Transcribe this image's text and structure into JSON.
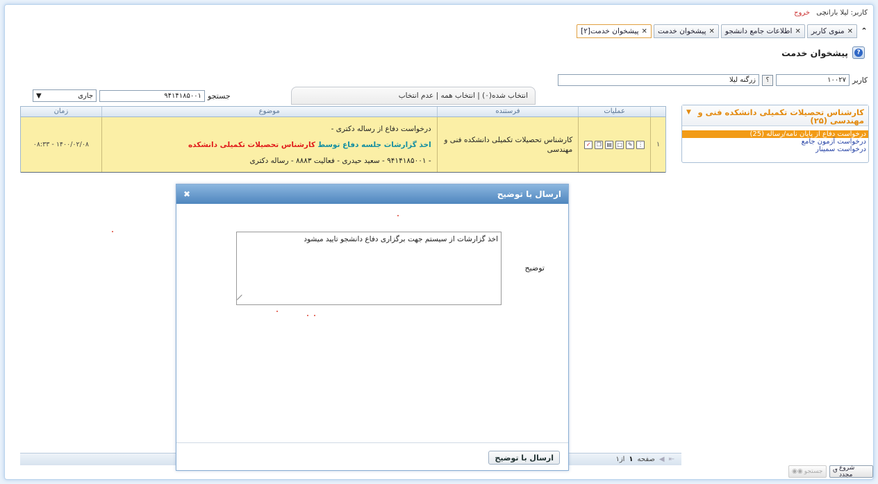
{
  "header": {
    "user_prefix": "کاربر: لیلا بارانچی",
    "logout": "خروج"
  },
  "tabs": [
    {
      "label": "منوی کاربر"
    },
    {
      "label": "اطلاعات جامع دانشجو"
    },
    {
      "label": "پیشخوان خدمت"
    },
    {
      "label": "پیشخوان خدمت[۲]"
    }
  ],
  "page_title": "پیشخوان خدمت",
  "user_row": {
    "label": "کاربر",
    "code": "۱۰۰۲۷",
    "name": "زرگنه لیلا",
    "help": "؟"
  },
  "selection": {
    "text": "انتخاب شده(۰) | انتخاب همه | عدم انتخاب"
  },
  "search": {
    "label": "جستجو",
    "value": "۹۴۱۴۱۸۵۰۰۱",
    "status_value": "جاری"
  },
  "grid": {
    "headers": {
      "ops": "عملیات",
      "sender": "فرستنده",
      "subject": "موضوع",
      "time": "زمان"
    },
    "row": {
      "index": "۱",
      "sender": "کارشناس تحصیلات تکمیلی دانشکده فنی و مهندسی",
      "subject_line1": "درخواست دفاع از رساله دکتری -",
      "subject_part_teal": "اخذ گزارشات جلسه دفاع توسط",
      "subject_part_red": "کارشناس تحصیلات تکمیلی دانشکده",
      "subject_line3": "- ۹۴۱۴۱۸۵۰۰۱ - سعید حیدری - فعالیت ۸۸۸۳ - رساله دکتری",
      "time": "۱۴۰۰/۰۲/۰۸ - ۰۸:۳۳"
    }
  },
  "left_panel": {
    "title": "کارشناس تحصیلات تکمیلی دانشکده فنی و مهندسی (۲۵)",
    "items": [
      "درخواست دفاع از پایان نامه/رساله (25)",
      "درخواست آزمون جامع",
      "درخواست سمینار"
    ]
  },
  "dialog": {
    "title": "ارسال با توضیح",
    "label": "توضیح",
    "textarea_value": "اخذ گزارشات از سیستم جهت برگزاری دفاع دانشجو تایید میشود",
    "button": "ارسال با توضیح"
  },
  "pager": {
    "page_label": "صفحه",
    "current": "۱",
    "of": "از۱"
  },
  "bottom": {
    "search_btn": "جستجو",
    "restart_btn": "شروع مجدد"
  }
}
